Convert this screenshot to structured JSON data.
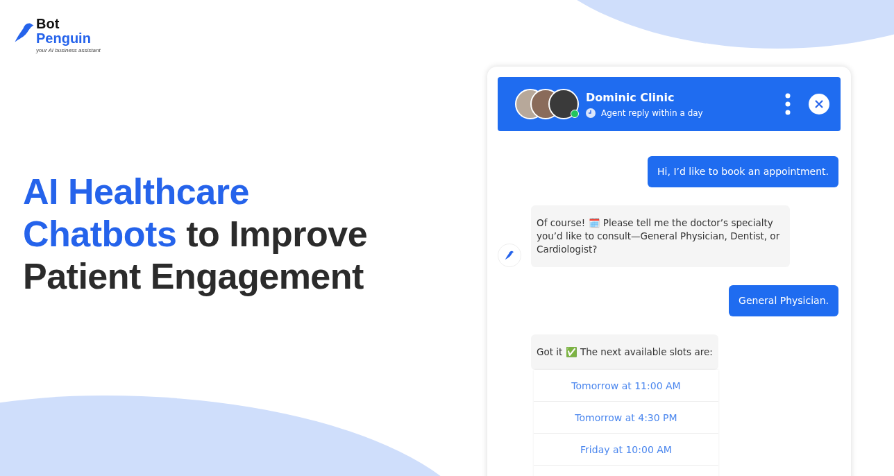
{
  "logo": {
    "line1": "Bot",
    "line2": "Penguin",
    "tagline": "your AI business assistant"
  },
  "headline": [
    [
      {
        "text": "AI Healthcare",
        "highlight": true
      }
    ],
    [
      {
        "text": "Chatbots",
        "highlight": true
      },
      {
        "text": " to Improve",
        "highlight": false
      }
    ],
    [
      {
        "text": "Patient Engagement",
        "highlight": false
      }
    ]
  ],
  "chat": {
    "title": "Dominic Clinic",
    "subtitle": "Agent reply within a day",
    "messages": [
      {
        "kind": "user",
        "text": "Hi, I’d like to book an appointment."
      },
      {
        "kind": "bot",
        "avatar": true,
        "text": "Of course! 🗓️ Please tell me the doctor’s specialty you’d like to consult—General Physician, Dentist, or Cardiologist?"
      },
      {
        "kind": "user",
        "text": "General Physician."
      },
      {
        "kind": "bot",
        "avatar": false,
        "text": "Got it ✅ The next available slots are:",
        "options": [
          "Tomorrow at 11:00 AM",
          "Tomorrow at 4:30 PM",
          "Friday at 10:00 AM"
        ]
      }
    ]
  }
}
